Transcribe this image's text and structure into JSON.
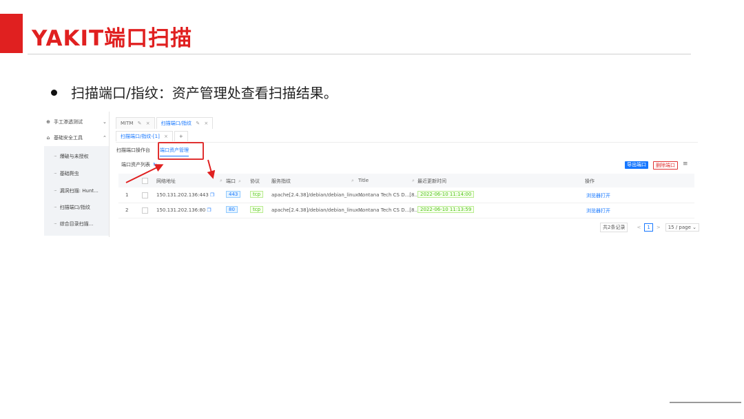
{
  "slide": {
    "title": "YAKIT端口扫描",
    "bullet": "扫描端口/指纹：资产管理处查看扫描结果。",
    "accent_color": "#e02020"
  },
  "sidebar": {
    "groups": [
      {
        "label": "手工渗透测试",
        "icon": "crosshair-icon",
        "chevron": "⌄"
      },
      {
        "label": "基础安全工具",
        "icon": "lock-icon",
        "chevron": "⌃"
      }
    ],
    "items": [
      "爆破与未授权",
      "基础爬虫",
      "漏洞扫描: Hunt...",
      "扫描端口/指纹",
      "综合目录扫描..."
    ]
  },
  "tabs": {
    "top": [
      {
        "label": "MITM",
        "edit": "✎",
        "close": "×"
      },
      {
        "label": "扫描端口/指纹",
        "edit": "✎",
        "close": "×"
      }
    ],
    "sub": [
      {
        "label": "扫描端口/指纹-[1]",
        "close": "×"
      },
      {
        "label": "+"
      }
    ]
  },
  "subtabs": [
    "扫描端口操作台",
    "端口资产管理"
  ],
  "list": {
    "title": "端口资产列表",
    "refresh_icon": "↻",
    "export_label": "导出端口",
    "delete_label": "删除端口",
    "menu_icon": "≡"
  },
  "table": {
    "columns": [
      "网络地址",
      "端口",
      "协议",
      "服务指纹",
      "Title",
      "最近更新时间",
      "操作"
    ],
    "rows": [
      {
        "id": "1",
        "addr": "150.131.202.136:443",
        "port": "443",
        "proto": "tcp",
        "service": "apache[2.4.38]/debian/debian_linux...",
        "title": "Montana Tech CS D...[8...",
        "time": "2022-06-10 11:14:00",
        "op": "浏览器打开"
      },
      {
        "id": "2",
        "addr": "150.131.202.136:80",
        "port": "80",
        "proto": "tcp",
        "service": "apache[2.4.38]/debian/debian_linux...",
        "title": "Montana Tech CS D...[8...",
        "time": "2022-06-10 11:13:59",
        "op": "浏览器打开"
      }
    ]
  },
  "pager": {
    "total": "共2条记录",
    "prev": "<",
    "current": "1",
    "next": ">",
    "size": "15 / page ⌄"
  }
}
